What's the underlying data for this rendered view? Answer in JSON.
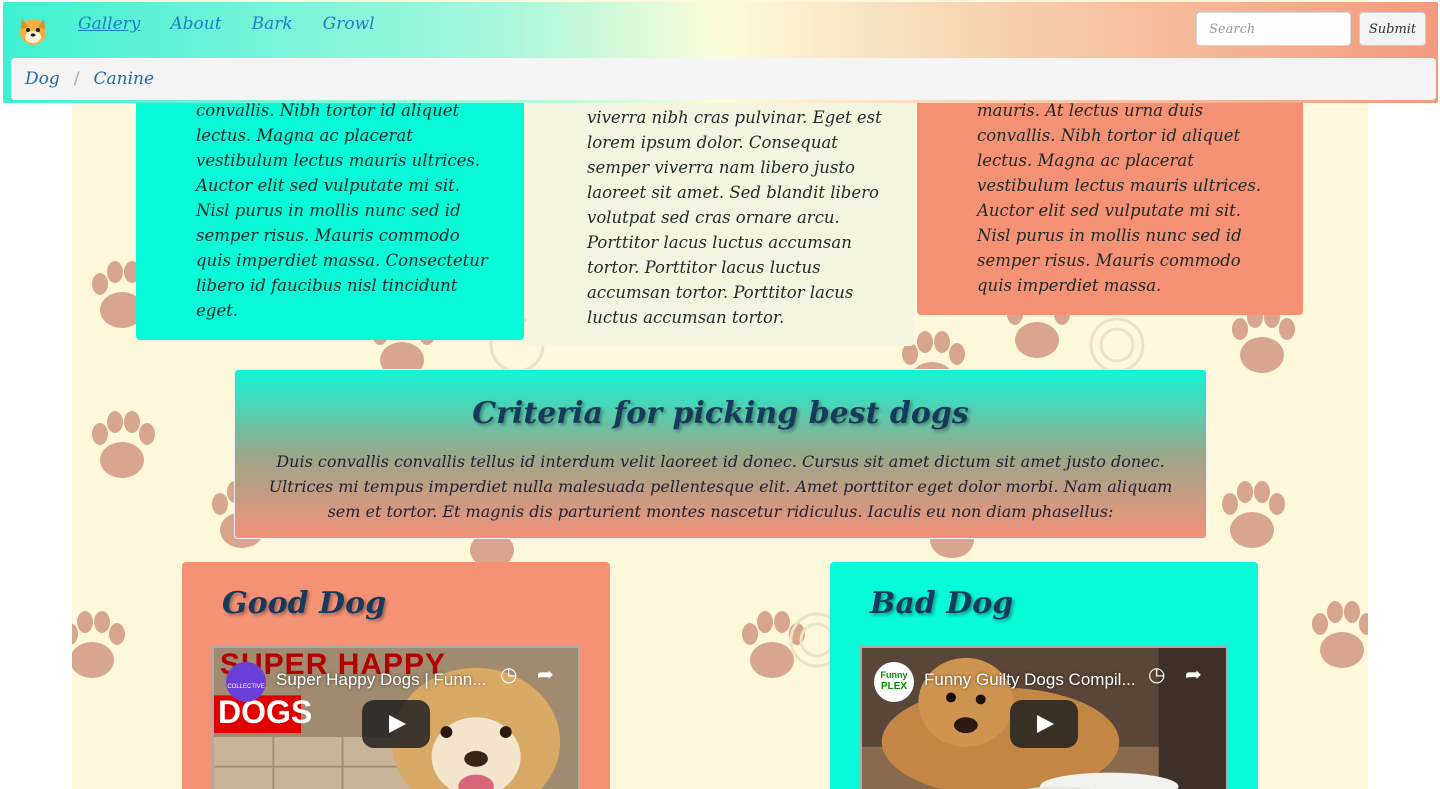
{
  "navbar": {
    "brand_icon": "dog-emoji-icon",
    "links": [
      {
        "label": "Gallery",
        "active": true
      },
      {
        "label": "About"
      },
      {
        "label": "Bark"
      },
      {
        "label": "Growl"
      }
    ],
    "search_placeholder": "Search",
    "submit_label": "Submit"
  },
  "breadcrumb": {
    "items": [
      "Dog",
      "Canine"
    ],
    "separator": "/"
  },
  "cards": [
    {
      "text": "convallis. Nibh tortor id aliquet lectus. Magna ac placerat vestibulum lectus mauris ultrices. Auctor elit sed vulputate mi sit. Nisl purus in mollis nunc sed id semper risus. Mauris commodo quis imperdiet massa. Consectetur libero id faucibus nisl tincidunt eget.",
      "color": "#08fad8"
    },
    {
      "text": "viverra nibh cras pulvinar. Eget est lorem ipsum dolor. Consequat semper viverra nam libero justo laoreet sit amet. Sed blandit libero volutpat sed cras ornare arcu. Porttitor lacus luctus accumsan tortor. Porttitor lacus luctus accumsan tortor. Porttitor lacus luctus accumsan tortor.",
      "color": "#f4f5e0"
    },
    {
      "text": "mauris. At lectus urna duis convallis. Nibh tortor id aliquet lectus. Magna ac placerat vestibulum lectus mauris ultrices. Auctor elit sed vulputate mi sit. Nisl purus in mollis nunc sed id semper risus. Mauris commodo quis imperdiet massa.",
      "color": "#f59276"
    }
  ],
  "criteria": {
    "title": "Criteria for picking best dogs",
    "body": "Duis convallis convallis tellus id interdum velit laoreet id donec. Cursus sit amet dictum sit amet justo donec. Ultrices mi tempus imperdiet nulla malesuada pellentesque elit. Amet porttitor eget dolor morbi. Nam aliquam sem et tortor. Et magnis dis parturient montes nascetur ridiculus. Iaculis eu non diam phasellus:"
  },
  "good_dog": {
    "title": "Good Dog",
    "video_title": "Super Happy Dogs | Funn...",
    "thumb_text_1": "SUPER HAPPY",
    "thumb_text_2": "DOGS",
    "channel_logo_text": "COLLECTIVE",
    "color": "#f59276"
  },
  "bad_dog": {
    "title": "Bad Dog",
    "video_title": "Funny Guilty Dogs Compil...",
    "channel_logo_text_1": "Funny",
    "channel_logo_text_2": "PLEX",
    "color": "#08fad8"
  },
  "colors": {
    "link": "#1f7fc6",
    "heading": "#163a5c",
    "background": "#fdf8dc",
    "paw": "#d8a58e"
  }
}
